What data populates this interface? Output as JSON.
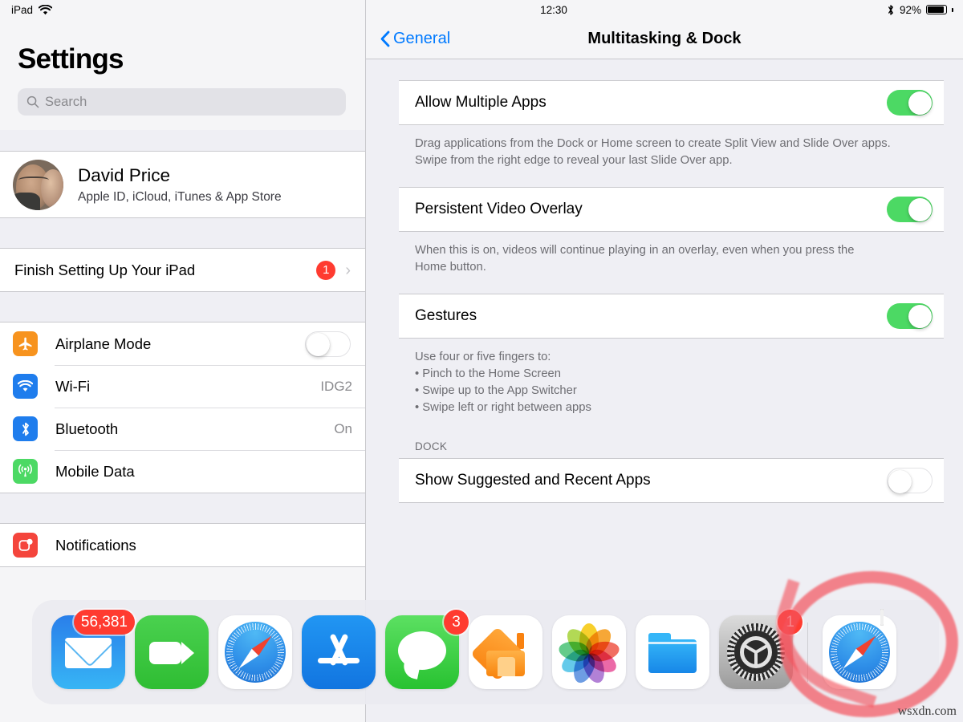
{
  "status_bar": {
    "device_label": "iPad",
    "wifi_icon": "wifi-icon",
    "time": "12:30",
    "bluetooth_icon": "bluetooth-icon",
    "battery_percent": "92%",
    "battery_icon": "battery-full-icon"
  },
  "sidebar": {
    "title": "Settings",
    "search": {
      "value": "",
      "placeholder": "Search",
      "icon": "search-icon"
    },
    "profile": {
      "name": "David Price",
      "subtitle": "Apple ID, iCloud, iTunes & App Store",
      "avatar_name": "user-avatar"
    },
    "setup_row": {
      "label": "Finish Setting Up Your iPad",
      "badge": "1",
      "chevron": "›"
    },
    "connectivity": [
      {
        "label": "Airplane Mode",
        "icon": "airplane-icon",
        "icon_color": "#f7931e",
        "control": "toggle",
        "state": "off",
        "value": ""
      },
      {
        "label": "Wi-Fi",
        "icon": "wifi-icon",
        "icon_color": "#1f7ded",
        "control": "value",
        "state": "",
        "value": "IDG2"
      },
      {
        "label": "Bluetooth",
        "icon": "bluetooth-icon",
        "icon_color": "#1f7ded",
        "control": "value",
        "state": "",
        "value": "On"
      },
      {
        "label": "Mobile Data",
        "icon": "cellular-icon",
        "icon_color": "#4cd964",
        "control": "value",
        "state": "",
        "value": ""
      }
    ],
    "partial_row": {
      "label": "Notifications",
      "icon": "notifications-icon",
      "icon_color": "#f4453c"
    }
  },
  "nav": {
    "back_label": "General",
    "back_icon": "chevron-left-icon",
    "title": "Multitasking & Dock"
  },
  "main": {
    "rows": [
      {
        "title": "Allow Multiple Apps",
        "toggle": "on",
        "description_lines": [
          "Drag applications from the Dock or Home screen to create Split View and Slide Over apps.",
          "Swipe from the right edge to reveal your last Slide Over app."
        ]
      },
      {
        "title": "Persistent Video Overlay",
        "toggle": "on",
        "description_lines": [
          "When this is on, videos will continue playing in an overlay, even when you press the",
          "Home button."
        ]
      },
      {
        "title": "Gestures",
        "toggle": "on",
        "description_lines": [
          "Use four or five fingers to:",
          "• Pinch to the Home Screen",
          "• Swipe up to the App Switcher",
          "• Swipe left or right between apps"
        ]
      }
    ],
    "dock_section_header": "DOCK",
    "dock_row": {
      "title": "Show Suggested and Recent Apps",
      "toggle": "off"
    }
  },
  "dock": {
    "apps": [
      {
        "name": "Mail",
        "icon": "mail-icon",
        "badge": "56,381"
      },
      {
        "name": "FaceTime",
        "icon": "facetime-icon",
        "badge": ""
      },
      {
        "name": "Safari",
        "icon": "safari-icon",
        "badge": ""
      },
      {
        "name": "App Store",
        "icon": "appstore-icon",
        "badge": ""
      },
      {
        "name": "Messages",
        "icon": "messages-icon",
        "badge": "3"
      },
      {
        "name": "Home",
        "icon": "home-icon",
        "badge": ""
      },
      {
        "name": "Photos",
        "icon": "photos-icon",
        "badge": ""
      },
      {
        "name": "Files",
        "icon": "files-icon",
        "badge": ""
      },
      {
        "name": "Settings",
        "icon": "settings-gear-icon",
        "badge": "1"
      }
    ],
    "recent": {
      "name": "Safari",
      "icon": "safari-icon",
      "handoff_icon": "handoff-display-icon"
    }
  },
  "annotation": {
    "shape": "red-circle-highlight",
    "color": "#f4535c"
  },
  "watermark": "wsxdn.com"
}
